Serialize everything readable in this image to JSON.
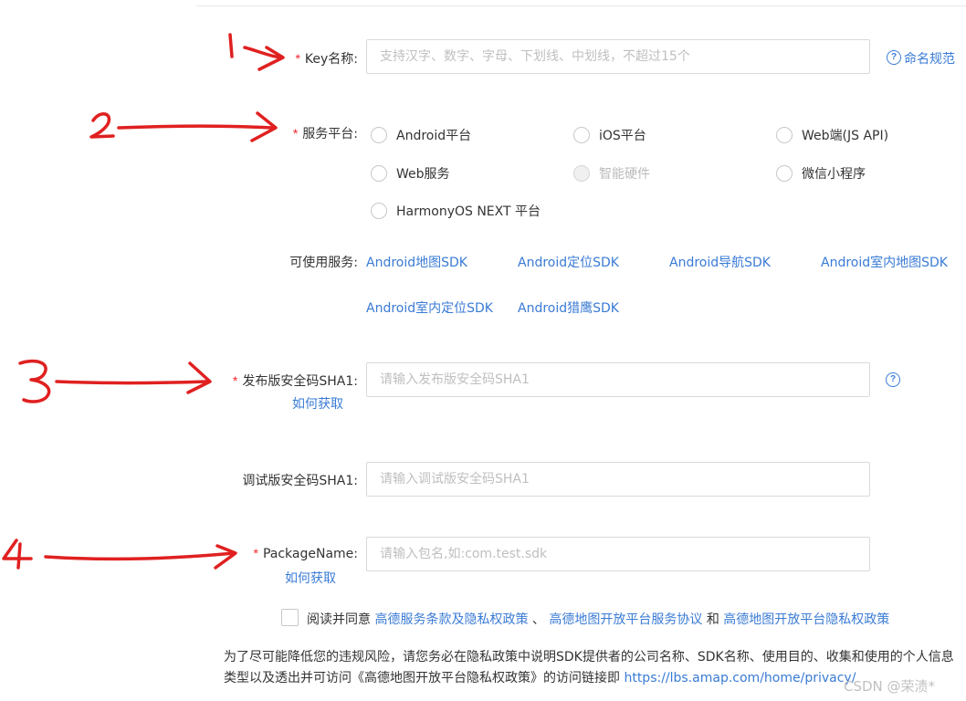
{
  "form": {
    "key_name": {
      "required_mark": "*",
      "label": "Key名称:",
      "placeholder": "支持汉字、数字、字母、下划线、中划线，不超过15个",
      "help_link": "命名规范"
    },
    "platform": {
      "required_mark": "*",
      "label": "服务平台:",
      "options": [
        {
          "label": "Android平台",
          "disabled": false
        },
        {
          "label": "iOS平台",
          "disabled": false
        },
        {
          "label": "Web端(JS API)",
          "disabled": false
        },
        {
          "label": "Web服务",
          "disabled": false
        },
        {
          "label": "智能硬件",
          "disabled": true
        },
        {
          "label": "微信小程序",
          "disabled": false
        },
        {
          "label": "HarmonyOS NEXT 平台",
          "disabled": false
        }
      ]
    },
    "services": {
      "label": "可使用服务:",
      "items": [
        "Android地图SDK",
        "Android定位SDK",
        "Android导航SDK",
        "Android室内地图SDK",
        "Android室内定位SDK",
        "Android猎鹰SDK"
      ]
    },
    "release_sha1": {
      "required_mark": "*",
      "label": "发布版安全码SHA1:",
      "placeholder": "请输入发布版安全码SHA1",
      "how_to_link": "如何获取"
    },
    "debug_sha1": {
      "label": "调试版安全码SHA1:",
      "placeholder": "请输入调试版安全码SHA1"
    },
    "package_name": {
      "required_mark": "*",
      "label": "PackageName:",
      "placeholder": "请输入包名,如:com.test.sdk",
      "how_to_link": "如何获取"
    },
    "agreement": {
      "prefix": "阅读并同意",
      "link1": "高德服务条款及隐私权政策",
      "sep1": "、",
      "link2": "高德地图开放平台服务协议",
      "sep2": "和",
      "link3": "高德地图开放平台隐私权政策"
    },
    "notice": {
      "text": "为了尽可能降低您的违规风险，请您务必在隐私政策中说明SDK提供者的公司名称、SDK名称、使用目的、收集和使用的个人信息类型以及透出并可访问《高德地图开放平台隐私权政策》的访问链接即",
      "link": "https://lbs.amap.com/home/privacy/"
    }
  },
  "annotations": [
    "1",
    "2",
    "3",
    "4"
  ],
  "watermark": "CSDN @荣渍*",
  "colors": {
    "link": "#3a7bd5",
    "required": "#f5222d",
    "annotation": "#e02020"
  }
}
